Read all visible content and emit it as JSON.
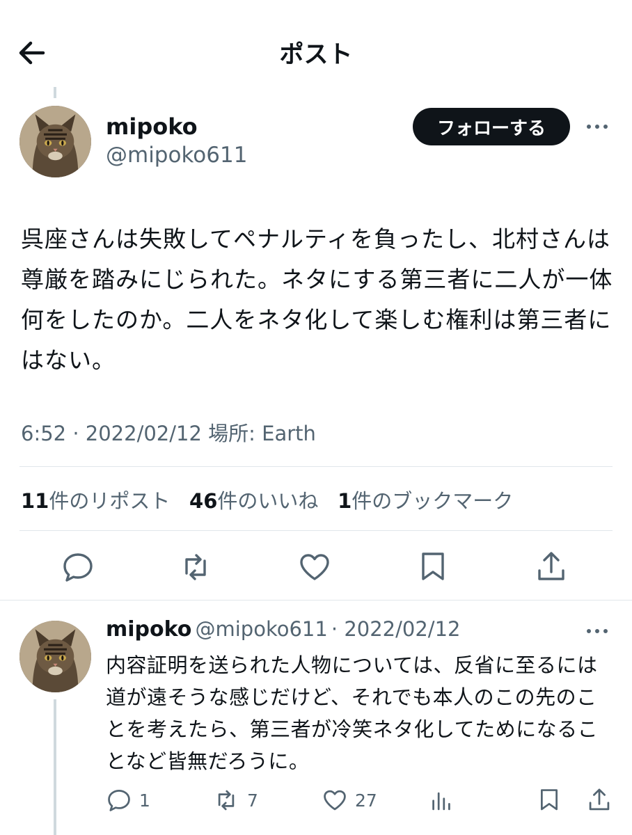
{
  "header": {
    "title": "ポスト",
    "back_icon": "arrow-left-icon"
  },
  "post": {
    "author": {
      "name": "mipoko",
      "handle": "@mipoko611",
      "avatar": "cat-avatar"
    },
    "follow_label": "フォローする",
    "more_icon": "ellipsis-icon",
    "text": "呉座さんは失敗してペナルティを負ったし、北村さんは尊厳を踏みにじられた。ネタにする第三者に二人が一体何をしたのか。二人をネタ化して楽しむ権利は第三者にはない。",
    "time": "6:52 · 2022/02/12 場所: Earth",
    "stats": {
      "reposts_count": "11",
      "reposts_label": "件のリポスト",
      "likes_count": "46",
      "likes_label": "件のいいね",
      "bookmarks_count": "1",
      "bookmarks_label": "件のブックマーク"
    }
  },
  "reply": {
    "author": {
      "name": "mipoko",
      "handle": "@mipoko611",
      "avatar": "cat-avatar"
    },
    "date": "· 2022/02/12",
    "text": "内容証明を送られた人物については、反省に至るには道が遠そうな感じだけど、それでも本人のこの先のことを考えたら、第三者が冷笑ネタ化してためになることなど皆無だろうに。",
    "counts": {
      "replies": "1",
      "reposts": "7",
      "likes": "27"
    }
  },
  "colors": {
    "text": "#0f1419",
    "secondary": "#536471",
    "divider": "#e1e6ea",
    "follow_bg": "#0f1419"
  }
}
